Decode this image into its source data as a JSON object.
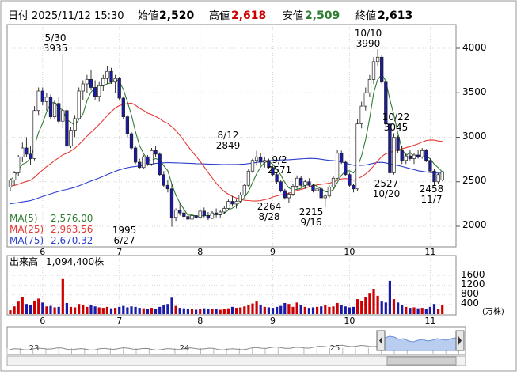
{
  "header": {
    "date_label": "日付",
    "datetime": "2025/11/12 15:30",
    "open_label": "始値",
    "open_value": "2,520",
    "high_label": "高値",
    "high_value": "2,618",
    "low_label": "安値",
    "low_value": "2,509",
    "close_label": "終値",
    "close_value": "2,613"
  },
  "colors": {
    "up": "#cc0000",
    "down": "#1a1aa8",
    "ma5": "#2e7d32",
    "ma25": "#e53935",
    "ma75": "#2b3fcf",
    "high_text": "#cc0000",
    "low_text": "#2e7d32",
    "navigator_fill": "#b9cdf0"
  },
  "price_chart": {
    "y_ticks": [
      "4000",
      "3500",
      "3000",
      "2500",
      "2000"
    ],
    "x_ticks": [
      "6",
      "7",
      "8",
      "9",
      "10",
      "11"
    ],
    "annotations": [
      {
        "date": "5/30",
        "value": "3935"
      },
      {
        "date": "8/12",
        "value": "2849"
      },
      {
        "date": "9/2",
        "value": "2571"
      },
      {
        "date": "10/10",
        "value": "3990"
      },
      {
        "date": "10/22",
        "value": "3045"
      },
      {
        "value": "1995",
        "date": "6/27"
      },
      {
        "value": "2264",
        "date": "8/28"
      },
      {
        "value": "2215",
        "date": "9/16"
      },
      {
        "value": "2527",
        "date": "10/20"
      },
      {
        "value": "2458",
        "date": "11/7"
      }
    ],
    "legend": [
      {
        "label": "MA(5)",
        "value": "2,576.00"
      },
      {
        "label": "MA(25)",
        "value": "2,963.56"
      },
      {
        "label": "MA(75)",
        "value": "2,670.32"
      }
    ]
  },
  "volume_chart": {
    "label": "出来高",
    "value": "1,094,400株",
    "y_ticks": [
      "1600",
      "1200",
      "800",
      "400"
    ],
    "unit": "(万株)"
  },
  "navigator": {
    "year_labels": [
      "23",
      "24",
      "25"
    ]
  },
  "chart_data": {
    "type": "candlestick",
    "ylim": [
      1700,
      4200
    ],
    "x_label_index": {
      "6": 8,
      "7": 27,
      "8": 47,
      "9": 65,
      "10": 84,
      "11": 104
    },
    "candles": [
      [
        2440,
        2540,
        2390,
        2520
      ],
      [
        2520,
        2620,
        2460,
        2600
      ],
      [
        2600,
        2800,
        2560,
        2780
      ],
      [
        2780,
        2940,
        2720,
        2880
      ],
      [
        2880,
        3000,
        2780,
        2810
      ],
      [
        2810,
        2900,
        2690,
        2760
      ],
      [
        2760,
        3350,
        2740,
        3300
      ],
      [
        3300,
        3560,
        3250,
        3520
      ],
      [
        3520,
        3560,
        3360,
        3400
      ],
      [
        3400,
        3500,
        3300,
        3450
      ],
      [
        3450,
        3480,
        3200,
        3230
      ],
      [
        3230,
        3420,
        3200,
        3380
      ],
      [
        3380,
        3450,
        3150,
        3180
      ],
      [
        3180,
        3935,
        3100,
        3300
      ],
      [
        3300,
        3350,
        2850,
        2900
      ],
      [
        2900,
        3120,
        2880,
        3080
      ],
      [
        3080,
        3250,
        3000,
        3210
      ],
      [
        3210,
        3560,
        3200,
        3520
      ],
      [
        3520,
        3640,
        3420,
        3600
      ],
      [
        3600,
        3700,
        3500,
        3650
      ],
      [
        3650,
        3760,
        3530,
        3560
      ],
      [
        3560,
        3640,
        3420,
        3460
      ],
      [
        3460,
        3620,
        3400,
        3580
      ],
      [
        3580,
        3700,
        3520,
        3660
      ],
      [
        3660,
        3800,
        3600,
        3740
      ],
      [
        3740,
        3780,
        3600,
        3620
      ],
      [
        3620,
        3700,
        3500,
        3660
      ],
      [
        3660,
        3680,
        3420,
        3440
      ],
      [
        3440,
        3460,
        3200,
        3230
      ],
      [
        3230,
        3250,
        3000,
        3040
      ],
      [
        3040,
        3060,
        2860,
        2880
      ],
      [
        2880,
        2900,
        2700,
        2720
      ],
      [
        2720,
        2760,
        2640,
        2660
      ],
      [
        2660,
        2800,
        2640,
        2780
      ],
      [
        2780,
        2800,
        2680,
        2700
      ],
      [
        2700,
        2880,
        2680,
        2850
      ],
      [
        2850,
        2900,
        2780,
        2810
      ],
      [
        2810,
        2830,
        2560,
        2580
      ],
      [
        2580,
        2620,
        2440,
        2460
      ],
      [
        2460,
        2520,
        2380,
        2420
      ],
      [
        2420,
        2480,
        1995,
        2100
      ],
      [
        2100,
        2200,
        2060,
        2180
      ],
      [
        2180,
        2260,
        2120,
        2150
      ],
      [
        2150,
        2200,
        2080,
        2110
      ],
      [
        2110,
        2140,
        2050,
        2080
      ],
      [
        2080,
        2150,
        2060,
        2120
      ],
      [
        2120,
        2180,
        2080,
        2100
      ],
      [
        2100,
        2200,
        2080,
        2170
      ],
      [
        2170,
        2210,
        2100,
        2120
      ],
      [
        2120,
        2160,
        2070,
        2090
      ],
      [
        2090,
        2170,
        2080,
        2150
      ],
      [
        2150,
        2200,
        2100,
        2130
      ],
      [
        2130,
        2180,
        2090,
        2160
      ],
      [
        2160,
        2230,
        2140,
        2200
      ],
      [
        2200,
        2300,
        2180,
        2280
      ],
      [
        2280,
        2340,
        2220,
        2250
      ],
      [
        2250,
        2300,
        2200,
        2280
      ],
      [
        2280,
        2380,
        2260,
        2350
      ],
      [
        2350,
        2480,
        2330,
        2460
      ],
      [
        2460,
        2640,
        2440,
        2620
      ],
      [
        2620,
        2760,
        2600,
        2740
      ],
      [
        2740,
        2849,
        2680,
        2780
      ],
      [
        2780,
        2820,
        2680,
        2720
      ],
      [
        2720,
        2780,
        2660,
        2740
      ],
      [
        2740,
        2760,
        2640,
        2660
      ],
      [
        2660,
        2680,
        2560,
        2580
      ],
      [
        2580,
        2600,
        2480,
        2500
      ],
      [
        2500,
        2520,
        2380,
        2400
      ],
      [
        2400,
        2420,
        2300,
        2320
      ],
      [
        2320,
        2380,
        2264,
        2360
      ],
      [
        2360,
        2480,
        2340,
        2450
      ],
      [
        2450,
        2571,
        2420,
        2540
      ],
      [
        2540,
        2560,
        2440,
        2460
      ],
      [
        2460,
        2520,
        2420,
        2500
      ],
      [
        2500,
        2540,
        2440,
        2460
      ],
      [
        2460,
        2480,
        2380,
        2400
      ],
      [
        2400,
        2440,
        2340,
        2420
      ],
      [
        2420,
        2440,
        2300,
        2320
      ],
      [
        2320,
        2360,
        2215,
        2340
      ],
      [
        2340,
        2460,
        2320,
        2440
      ],
      [
        2440,
        2560,
        2420,
        2540
      ],
      [
        2540,
        2860,
        2520,
        2820
      ],
      [
        2820,
        2850,
        2700,
        2720
      ],
      [
        2720,
        2740,
        2560,
        2580
      ],
      [
        2580,
        2600,
        2440,
        2460
      ],
      [
        2460,
        2480,
        2380,
        2420
      ],
      [
        2420,
        3200,
        2400,
        3150
      ],
      [
        3150,
        3400,
        3100,
        3350
      ],
      [
        3350,
        3560,
        3300,
        3500
      ],
      [
        3500,
        3700,
        3450,
        3650
      ],
      [
        3650,
        3900,
        3600,
        3850
      ],
      [
        3850,
        3990,
        3800,
        3900
      ],
      [
        3900,
        3920,
        3600,
        3620
      ],
      [
        3620,
        3640,
        3100,
        3150
      ],
      [
        3150,
        3180,
        2527,
        2600
      ],
      [
        2600,
        3045,
        2580,
        3000
      ],
      [
        3000,
        3020,
        2820,
        2850
      ],
      [
        2850,
        2900,
        2700,
        2740
      ],
      [
        2740,
        2820,
        2700,
        2790
      ],
      [
        2790,
        2860,
        2740,
        2760
      ],
      [
        2760,
        2820,
        2700,
        2800
      ],
      [
        2800,
        2860,
        2760,
        2780
      ],
      [
        2780,
        2880,
        2760,
        2850
      ],
      [
        2850,
        2870,
        2720,
        2740
      ],
      [
        2740,
        2760,
        2600,
        2620
      ],
      [
        2620,
        2640,
        2458,
        2500
      ],
      [
        2500,
        2600,
        2480,
        2580
      ],
      [
        2520,
        2618,
        2509,
        2613
      ]
    ],
    "volumes": [
      160,
      320,
      520,
      700,
      420,
      380,
      560,
      640,
      480,
      320,
      340,
      280,
      300,
      1450,
      460,
      300,
      280,
      420,
      380,
      300,
      360,
      320,
      280,
      260,
      300,
      240,
      260,
      300,
      340,
      280,
      320,
      300,
      260,
      240,
      220,
      260,
      200,
      300,
      380,
      420,
      680,
      340,
      260,
      240,
      220,
      200,
      180,
      220,
      240,
      200,
      200,
      220,
      180,
      200,
      240,
      300,
      260,
      280,
      320,
      380,
      440,
      520,
      380,
      300,
      280,
      260,
      300,
      340,
      460,
      420,
      300,
      480,
      380,
      300,
      260,
      280,
      300,
      320,
      360,
      300,
      320,
      460,
      380,
      320,
      280,
      300,
      620,
      560,
      700,
      880,
      1050,
      760,
      520,
      480,
      1380,
      620,
      480,
      360,
      300,
      260,
      280,
      240,
      260,
      220,
      300,
      420,
      220,
      360
    ]
  }
}
